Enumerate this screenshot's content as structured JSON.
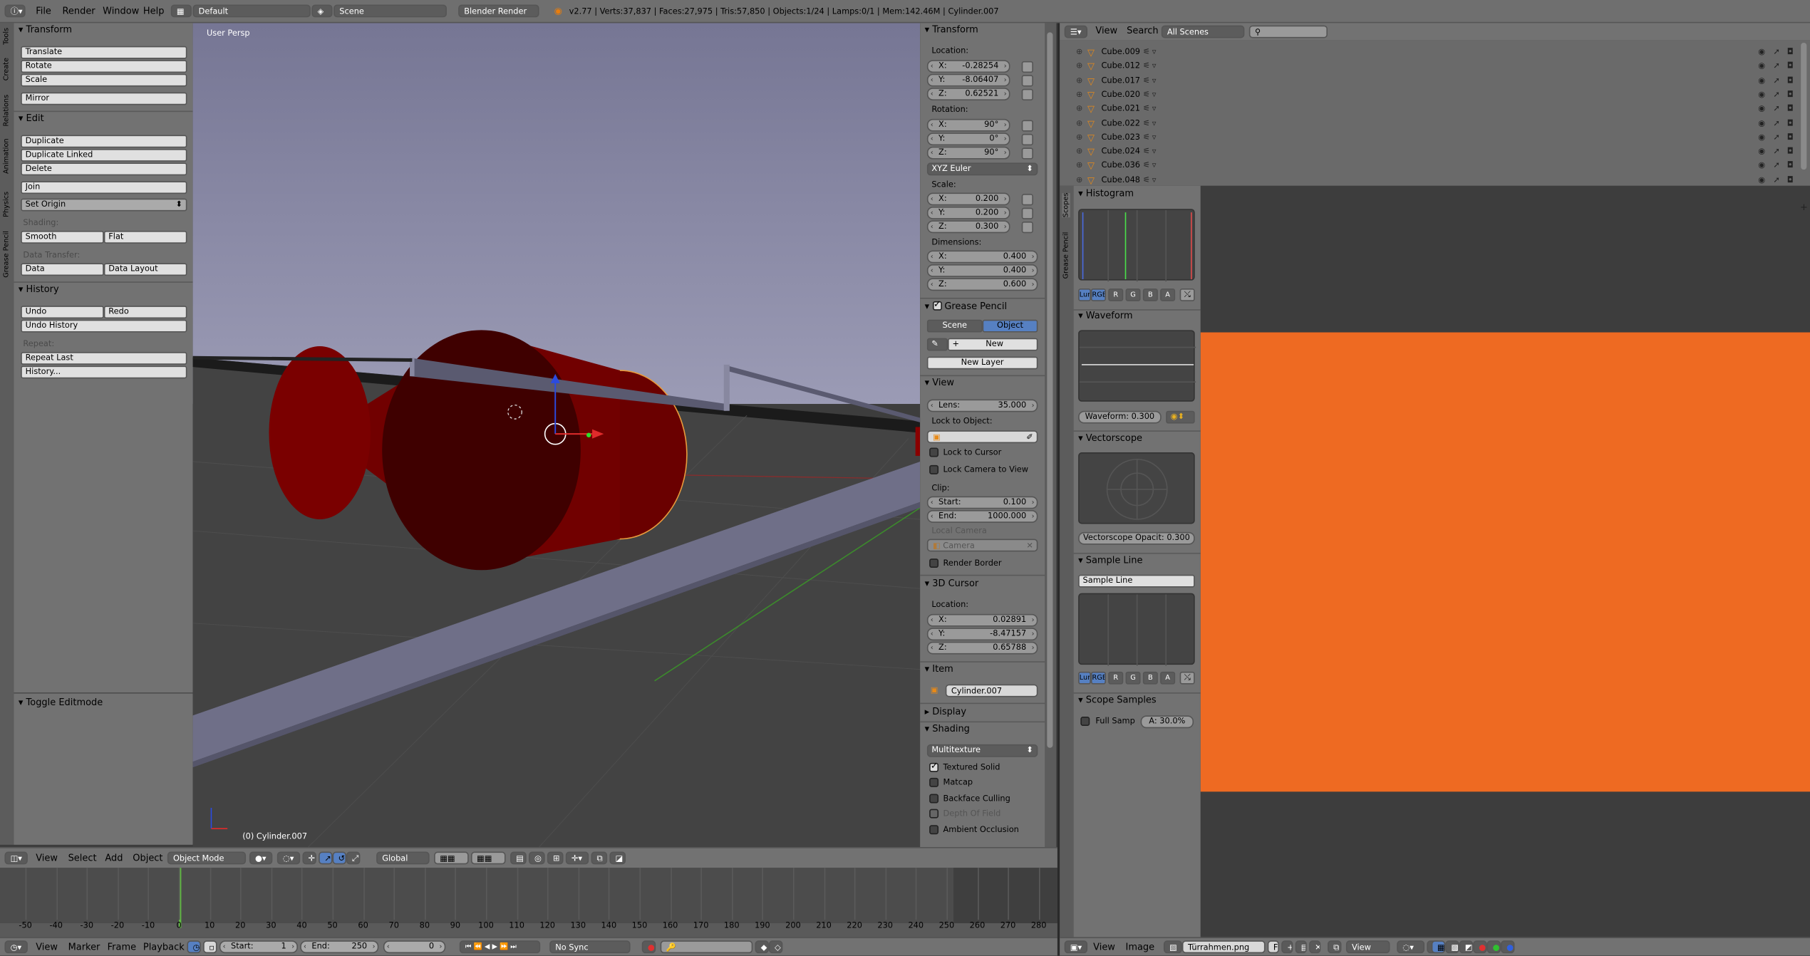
{
  "topbar": {
    "menus": [
      "File",
      "Render",
      "Window",
      "Help"
    ],
    "layout": "Default",
    "scene": "Scene",
    "engine": "Blender Render",
    "stats": "v2.77 | Verts:37,837 | Faces:27,975 | Tris:57,850 | Objects:1/24 | Lamps:0/1 | Mem:142.46M | Cylinder.007"
  },
  "tools": {
    "tabs": [
      "Tools",
      "Create",
      "Relations",
      "Animation",
      "Physics",
      "Grease Pencil"
    ],
    "transform": {
      "title": "Transform",
      "buttons": [
        "Translate",
        "Rotate",
        "Scale",
        "Mirror"
      ]
    },
    "edit": {
      "title": "Edit",
      "buttons": [
        "Duplicate",
        "Duplicate Linked",
        "Delete",
        "Join"
      ],
      "set_origin": "Set Origin",
      "shading_label": "Shading:",
      "smooth": "Smooth",
      "flat": "Flat",
      "data_transfer_label": "Data Transfer:",
      "data": "Data",
      "data_layout": "Data Layout"
    },
    "history": {
      "title": "History",
      "undo": "Undo",
      "redo": "Redo",
      "undo_history": "Undo History",
      "repeat_label": "Repeat:",
      "repeat_last": "Repeat Last",
      "history_btn": "History..."
    },
    "operator": "Toggle Editmode"
  },
  "viewport": {
    "view_label": "User Persp",
    "object_label": "(0) Cylinder.007",
    "header": {
      "menus": [
        "View",
        "Select",
        "Add",
        "Object"
      ],
      "mode": "Object Mode",
      "orientation": "Global"
    }
  },
  "properties": {
    "transform_title": "Transform",
    "location_label": "Location:",
    "location": [
      {
        "k": "X:",
        "v": "-0.28254"
      },
      {
        "k": "Y:",
        "v": "-8.06407"
      },
      {
        "k": "Z:",
        "v": "0.62521"
      }
    ],
    "rotation_label": "Rotation:",
    "rotation": [
      {
        "k": "X:",
        "v": "90°"
      },
      {
        "k": "Y:",
        "v": "0°"
      },
      {
        "k": "Z:",
        "v": "90°"
      }
    ],
    "rotation_mode": "XYZ Euler",
    "scale_label": "Scale:",
    "scale": [
      {
        "k": "X:",
        "v": "0.200"
      },
      {
        "k": "Y:",
        "v": "0.200"
      },
      {
        "k": "Z:",
        "v": "0.300"
      }
    ],
    "dimensions_label": "Dimensions:",
    "dimensions": [
      {
        "k": "X:",
        "v": "0.400"
      },
      {
        "k": "Y:",
        "v": "0.400"
      },
      {
        "k": "Z:",
        "v": "0.600"
      }
    ],
    "grease_pencil": {
      "title": "Grease Pencil",
      "scene": "Scene",
      "object": "Object",
      "new": "New",
      "new_layer": "New Layer"
    },
    "view": {
      "title": "View",
      "lens_label": "Lens:",
      "lens": "35.000",
      "lock_to_object": "Lock to Object:",
      "lock_cursor": "Lock to Cursor",
      "lock_camera": "Lock Camera to View",
      "clip_label": "Clip:",
      "start_label": "Start:",
      "start": "0.100",
      "end_label": "End:",
      "end": "1000.000",
      "local_camera": "Local Camera",
      "camera": "Camera",
      "render_border": "Render Border"
    },
    "cursor": {
      "title": "3D Cursor",
      "location_label": "Location:",
      "values": [
        {
          "k": "X:",
          "v": "0.02891"
        },
        {
          "k": "Y:",
          "v": "-8.47157"
        },
        {
          "k": "Z:",
          "v": "0.65788"
        }
      ]
    },
    "item": {
      "title": "Item",
      "name": "Cylinder.007"
    },
    "display_title": "Display",
    "shading": {
      "title": "Shading",
      "mode": "Multitexture",
      "options": [
        "Textured Solid",
        "Matcap",
        "Backface Culling",
        "Depth Of Field",
        "Ambient Occlusion"
      ]
    }
  },
  "outliner": {
    "menus": [
      "View",
      "Search"
    ],
    "filter": "All Scenes",
    "items": [
      "Cube.009",
      "Cube.012",
      "Cube.017",
      "Cube.020",
      "Cube.021",
      "Cube.022",
      "Cube.023",
      "Cube.024",
      "Cube.036",
      "Cube.048"
    ]
  },
  "scopes": {
    "tabs": [
      "Scopes",
      "Grease Pencil"
    ],
    "histogram": "Histogram",
    "channels": [
      "Lum",
      "RGB",
      "R",
      "G",
      "B",
      "A"
    ],
    "waveform": "Waveform",
    "waveform_opacity": "Waveform: 0.300",
    "vectorscope": "Vectorscope",
    "vectorscope_opacity": "Vectorscope Opacit: 0.300",
    "sample_line_title": "Sample Line",
    "sample_line_btn": "Sample Line",
    "scope_samples": "Scope Samples",
    "full_samp": "Full Samp",
    "accuracy": "A: 30.0%"
  },
  "image_editor": {
    "menus": [
      "View",
      "Image"
    ],
    "image_name": "Türrahmen.png",
    "view": "View",
    "fill_color": "#ee6a22"
  },
  "timeline": {
    "menus": [
      "View",
      "Marker",
      "Frame",
      "Playback"
    ],
    "start_label": "Start:",
    "start": "1",
    "end_label": "End:",
    "end": "250",
    "current": "0",
    "sync": "No Sync",
    "ticks": [
      "-50",
      "-40",
      "-30",
      "-20",
      "-10",
      "0",
      "10",
      "20",
      "30",
      "40",
      "50",
      "60",
      "70",
      "80",
      "90",
      "100",
      "110",
      "120",
      "130",
      "140",
      "150",
      "160",
      "170",
      "180",
      "190",
      "200",
      "210",
      "220",
      "230",
      "240",
      "250",
      "260",
      "270",
      "280"
    ]
  }
}
